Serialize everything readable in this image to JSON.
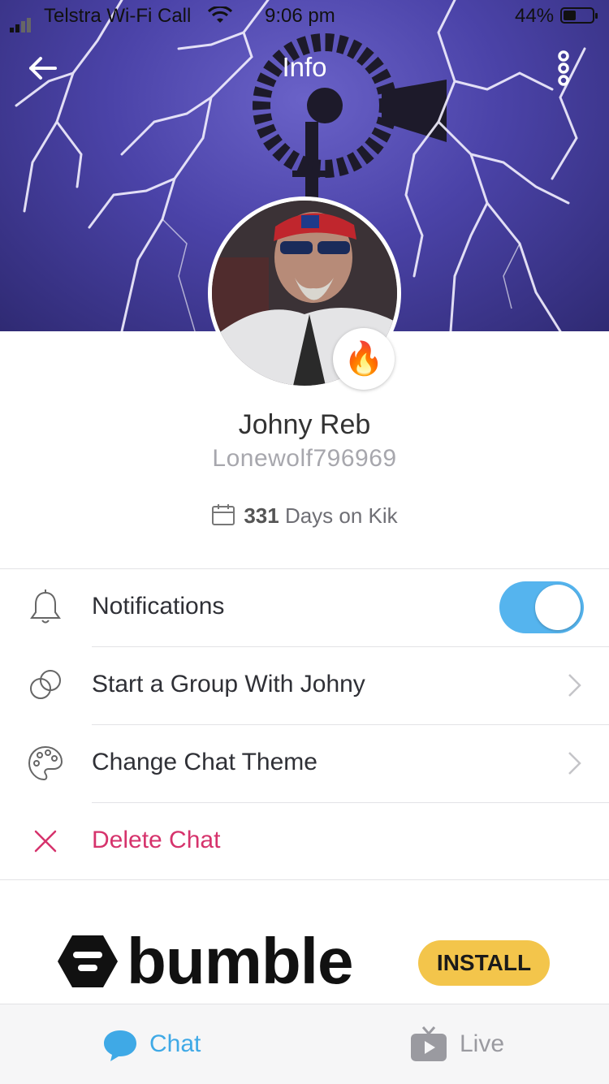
{
  "status_bar": {
    "carrier": "Telstra Wi-Fi Call",
    "time": "9:06 pm",
    "battery": "44%"
  },
  "header": {
    "title": "Info"
  },
  "profile": {
    "display_name": "Johny Reb",
    "username": "Lonewolf796969",
    "days_count": "331",
    "days_suffix": " Days on Kik"
  },
  "menu": {
    "notifications_label": "Notifications",
    "notifications_on": true,
    "start_group_label": "Start a Group With Johny",
    "theme_label": "Change Chat Theme",
    "delete_label": "Delete Chat"
  },
  "ad": {
    "brand": "bumble",
    "cta": "INSTALL"
  },
  "tabbar": {
    "chat_label": "Chat",
    "live_label": "Live"
  },
  "colors": {
    "accent": "#3fa9e6",
    "toggle_on": "#55b4ee",
    "danger": "#d6336c",
    "ad_button": "#f3c54b"
  }
}
